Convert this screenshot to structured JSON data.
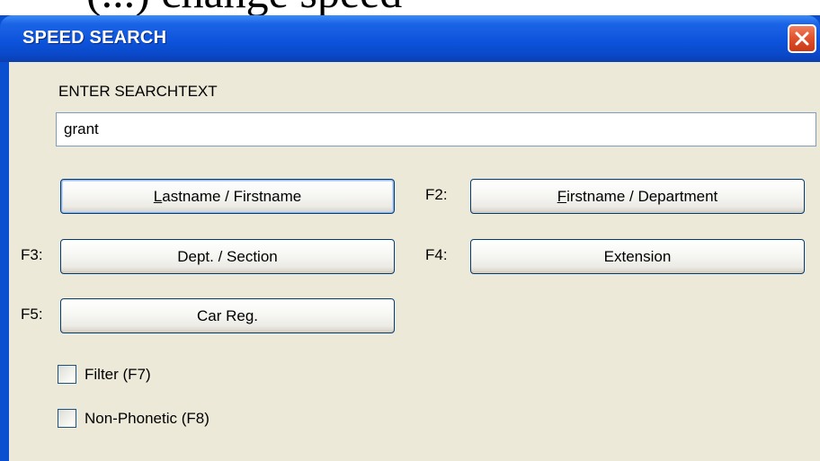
{
  "background_caption": "(...) change speed",
  "window": {
    "title": "SPEED SEARCH"
  },
  "search": {
    "label": "ENTER SEARCHTEXT",
    "value": "grant"
  },
  "buttons": {
    "lastname_firstname": {
      "mnemonic": "L",
      "rest": "astname / Firstname",
      "key": ""
    },
    "firstname_department": {
      "mnemonic": "F",
      "rest": "irstname / Department",
      "key": "F2:"
    },
    "dept_section": {
      "label": "Dept. / Section",
      "key": "F3:"
    },
    "extension": {
      "label": "Extension",
      "key": "F4:"
    },
    "car_reg": {
      "label": "Car Reg.",
      "key": "F5:"
    }
  },
  "options": {
    "filter": {
      "label": "Filter (F7)",
      "checked": false
    },
    "non_phonetic": {
      "label": "Non-Phonetic (F8)",
      "checked": false
    }
  },
  "colors": {
    "titlebar": "#0a4fd0",
    "client": "#ece9d8",
    "close": "#e2542f"
  },
  "icons": {
    "close": "close-icon"
  }
}
